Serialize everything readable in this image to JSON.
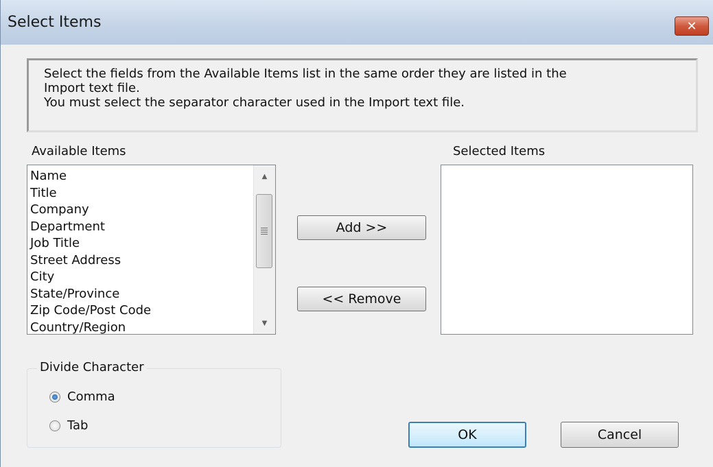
{
  "dialog": {
    "title": "Select Items",
    "close_glyph": "✕"
  },
  "instructions": {
    "line1": "Select the fields from the Available Items list in the same order they are listed in the",
    "line2": "Import text file.",
    "line3": "You must select the separator character used in the Import text file."
  },
  "available": {
    "label": "Available Items",
    "items": [
      "Name",
      "Title",
      "Company",
      "Department",
      "Job Title",
      "Street Address",
      "City",
      "State/Province",
      "Zip Code/Post Code",
      "Country/Region"
    ]
  },
  "selected": {
    "label": "Selected Items",
    "items": []
  },
  "buttons": {
    "add": "Add >>",
    "remove": "<< Remove",
    "ok": "OK",
    "cancel": "Cancel"
  },
  "divide": {
    "legend": "Divide Character",
    "options": [
      "Comma",
      "Tab"
    ],
    "selected": "Comma"
  },
  "icons": {
    "close": "close-icon",
    "scroll_up": "scroll-up-arrow-icon",
    "scroll_down": "scroll-down-arrow-icon",
    "thumb_grip": "scroll-grip-icon"
  },
  "colors": {
    "titlebar": "#c4d3e6",
    "close_button": "#c84b2f",
    "default_button_border": "#3c7fb1"
  }
}
